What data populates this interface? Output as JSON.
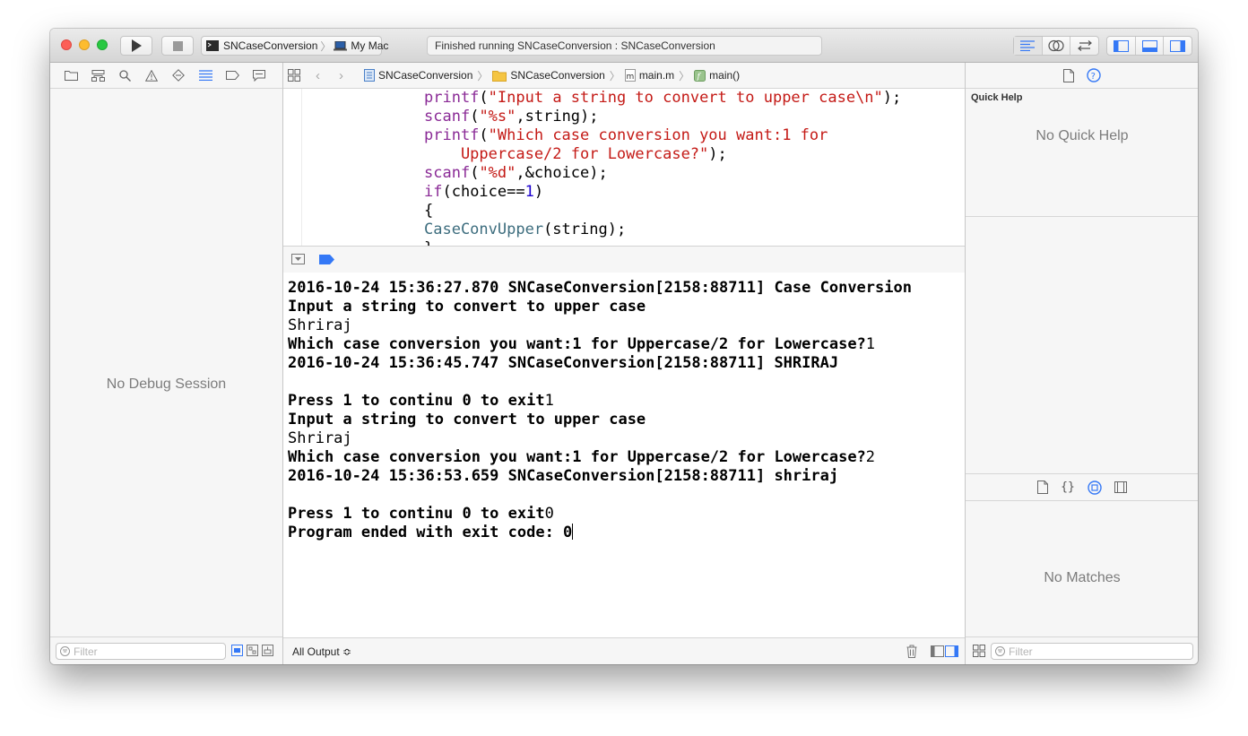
{
  "toolbar": {
    "scheme_target": "SNCaseConversion",
    "scheme_device": "My Mac",
    "activity_status": "Finished running SNCaseConversion : SNCaseConversion",
    "run_icon": "play-icon",
    "stop_icon": "stop-icon"
  },
  "navigator": {
    "empty_message": "No Debug Session",
    "filter_placeholder": "Filter",
    "tabs": [
      "folder-icon",
      "hierarchy-icon",
      "search-icon",
      "warning-icon",
      "test-icon",
      "debug-icon",
      "breakpoint-icon",
      "report-icon"
    ]
  },
  "jumpbar": {
    "crumbs": [
      "SNCaseConversion",
      "SNCaseConversion",
      "main.m",
      "main()"
    ]
  },
  "editor": {
    "lines": [
      {
        "parts": [
          {
            "t": "printf",
            "c": "kw"
          },
          {
            "t": "(",
            "c": ""
          },
          {
            "t": "\"Input a string to convert to upper case\\n\"",
            "c": "str"
          },
          {
            "t": ");",
            "c": ""
          }
        ]
      },
      {
        "parts": [
          {
            "t": "scanf",
            "c": "kw"
          },
          {
            "t": "(",
            "c": ""
          },
          {
            "t": "\"%s\"",
            "c": "str"
          },
          {
            "t": ",string);",
            "c": ""
          }
        ]
      },
      {
        "parts": [
          {
            "t": "printf",
            "c": "kw"
          },
          {
            "t": "(",
            "c": ""
          },
          {
            "t": "\"Which case conversion you want:1 for",
            "c": "str"
          }
        ]
      },
      {
        "parts": [
          {
            "t": "    Uppercase/2 for Lowercase?\"",
            "c": "str"
          },
          {
            "t": ");",
            "c": ""
          }
        ]
      },
      {
        "parts": [
          {
            "t": "scanf",
            "c": "kw"
          },
          {
            "t": "(",
            "c": ""
          },
          {
            "t": "\"%d\"",
            "c": "str"
          },
          {
            "t": ",&choice);",
            "c": ""
          }
        ]
      },
      {
        "parts": [
          {
            "t": "if",
            "c": "kw"
          },
          {
            "t": "(choice==",
            "c": ""
          },
          {
            "t": "1",
            "c": "num"
          },
          {
            "t": ")",
            "c": ""
          }
        ]
      },
      {
        "parts": [
          {
            "t": "{",
            "c": ""
          }
        ]
      },
      {
        "parts": [
          {
            "t": "CaseConvUpper",
            "c": "fn"
          },
          {
            "t": "(string);",
            "c": ""
          }
        ]
      },
      {
        "parts": [
          {
            "t": "}",
            "c": ""
          }
        ]
      }
    ]
  },
  "console": {
    "lines": [
      {
        "text": "2016-10-24 15:36:27.870 SNCaseConversion[2158:88711] Case Conversion",
        "bold": true
      },
      {
        "text": "Input a string to convert to upper case",
        "bold": true
      },
      {
        "text": "Shriraj",
        "bold": false
      },
      {
        "text": "Which case conversion you want:1 for Uppercase/2 for Lowercase?",
        "bold": true,
        "tail": "1"
      },
      {
        "text": "2016-10-24 15:36:45.747 SNCaseConversion[2158:88711] SHRIRAJ",
        "bold": true
      },
      {
        "text": "",
        "bold": false
      },
      {
        "text": "Press 1 to continu 0 to exit",
        "bold": true,
        "tail": "1"
      },
      {
        "text": "Input a string to convert to upper case",
        "bold": true
      },
      {
        "text": "Shriraj",
        "bold": false
      },
      {
        "text": "Which case conversion you want:1 for Uppercase/2 for Lowercase?",
        "bold": true,
        "tail": "2"
      },
      {
        "text": "2016-10-24 15:36:53.659 SNCaseConversion[2158:88711] shriraj",
        "bold": true
      },
      {
        "text": "",
        "bold": false
      },
      {
        "text": "Press 1 to continu 0 to exit",
        "bold": true,
        "tail": "0"
      },
      {
        "text": "Program ended with exit code: 0",
        "bold": true,
        "caret": true
      }
    ],
    "output_selector": "All Output ≎"
  },
  "inspector": {
    "quick_help_title": "Quick Help",
    "quick_help_empty": "No Quick Help",
    "library_empty": "No Matches",
    "filter_placeholder": "Filter"
  },
  "colors": {
    "accent": "#3478f6",
    "keyword": "#8a2a96",
    "string": "#c41a16",
    "number": "#1c00cf"
  }
}
